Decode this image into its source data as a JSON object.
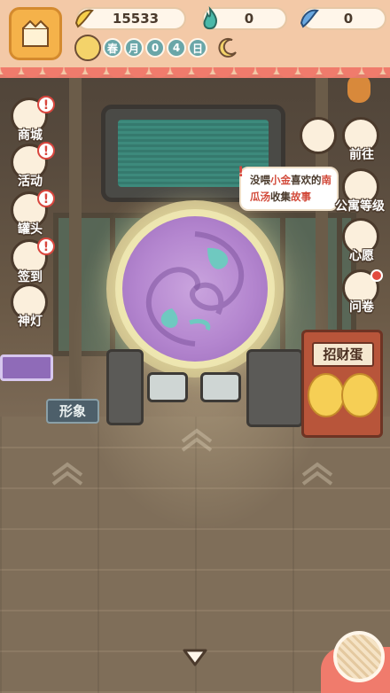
{
  "resources": {
    "banana": "15533",
    "fire": "0",
    "blue_banana": "0"
  },
  "date": {
    "chars": [
      "春",
      "月",
      "0",
      "4",
      "日"
    ]
  },
  "left_menu": [
    {
      "label": "商城",
      "alert": "!"
    },
    {
      "label": "活动",
      "alert": "!"
    },
    {
      "label": "罐头",
      "alert": "!"
    },
    {
      "label": "签到",
      "alert": "!"
    },
    {
      "label": "神灯",
      "alert": ""
    }
  ],
  "right_menu": [
    {
      "label": "前往"
    },
    {
      "label": "公寓等级"
    },
    {
      "label": "心愿"
    },
    {
      "label": "问卷"
    }
  ],
  "quest": {
    "alert": "!",
    "p1": "没喂",
    "p2": "小金",
    "p3": "喜欢的",
    "p4": "南",
    "p5": "瓜汤",
    "p6": "收集",
    "p7": "故事"
  },
  "sign_appearance": "形象",
  "sign_egg": "招财蛋",
  "colors": {
    "awning": "#f3c9a7",
    "awning_trim": "#f07b6c",
    "alert_red": "#d9463e",
    "portal": "#b486cf",
    "label_outline": "#4b3a2c"
  },
  "icons": [
    "banana-icon",
    "fire-icon",
    "blue-banana-icon",
    "sun-icon",
    "moon-icon",
    "yarn-ball-icon",
    "down-arrow-icon"
  ]
}
